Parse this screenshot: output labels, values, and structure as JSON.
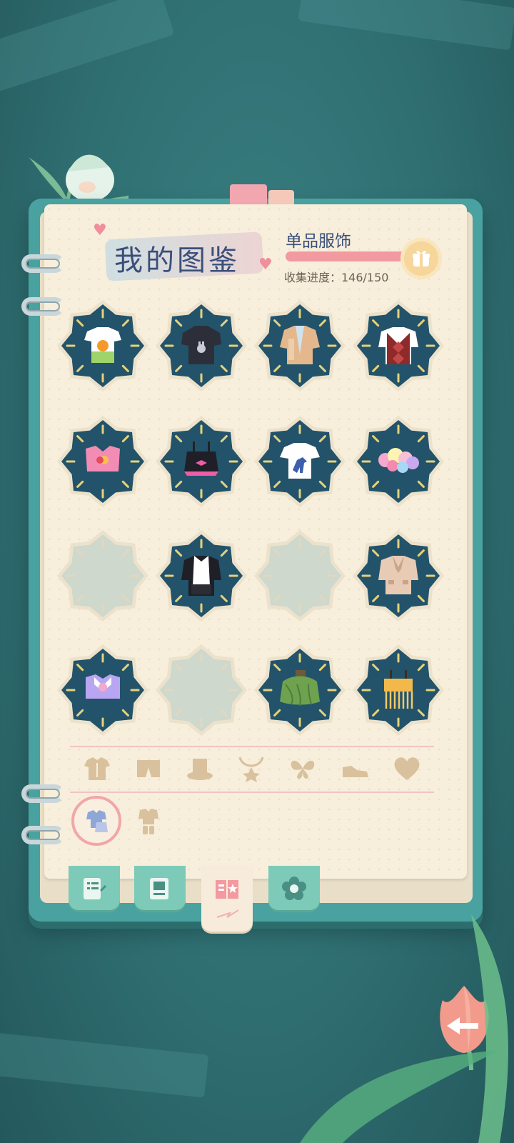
{
  "header": {
    "title": "我的图鉴",
    "category_label": "单品服饰",
    "progress_text": "收集进度：146/150",
    "progress_fraction": 0.973
  },
  "colors": {
    "background": "#2f6f72",
    "book_cover": "#4aa2a0",
    "paper": "#f7eedb",
    "slot_dark": "#23536a",
    "slot_locked": "#cfd8cc",
    "accent_pink": "#f29aa0",
    "title_blue": "#3a4f7a"
  },
  "grid": {
    "items": [
      {
        "name": "orange-tshirt",
        "collected": true
      },
      {
        "name": "black-bunny-hoodie",
        "collected": true
      },
      {
        "name": "tan-jacket",
        "collected": true
      },
      {
        "name": "argyle-vest",
        "collected": true
      },
      {
        "name": "pink-crop-top",
        "collected": true
      },
      {
        "name": "black-bow-camisole",
        "collected": true
      },
      {
        "name": "dinosaur-tshirt",
        "collected": true
      },
      {
        "name": "flower-bandeau",
        "collected": true
      },
      {
        "name": "locked-slot",
        "collected": false
      },
      {
        "name": "black-white-blouse",
        "collected": true
      },
      {
        "name": "locked-slot",
        "collected": false
      },
      {
        "name": "beige-jacket",
        "collected": true
      },
      {
        "name": "purple-bow-top",
        "collected": true
      },
      {
        "name": "locked-slot",
        "collected": false
      },
      {
        "name": "leaf-skirt",
        "collected": true
      },
      {
        "name": "fringe-top",
        "collected": true
      }
    ]
  },
  "categories": [
    {
      "icon": "shirt-icon"
    },
    {
      "icon": "pants-icon"
    },
    {
      "icon": "hat-icon"
    },
    {
      "icon": "necklace-icon"
    },
    {
      "icon": "wings-icon"
    },
    {
      "icon": "shoe-icon"
    },
    {
      "icon": "heart-icon"
    }
  ],
  "sub_categories": [
    {
      "icon": "outfit-icon",
      "selected": true
    },
    {
      "icon": "dress-icon",
      "selected": false
    }
  ],
  "bottom_tabs": [
    {
      "icon": "notes-icon",
      "active": false
    },
    {
      "icon": "album-icon",
      "active": false
    },
    {
      "icon": "collection-book-icon",
      "active": true
    },
    {
      "icon": "flower-icon",
      "active": false
    }
  ]
}
